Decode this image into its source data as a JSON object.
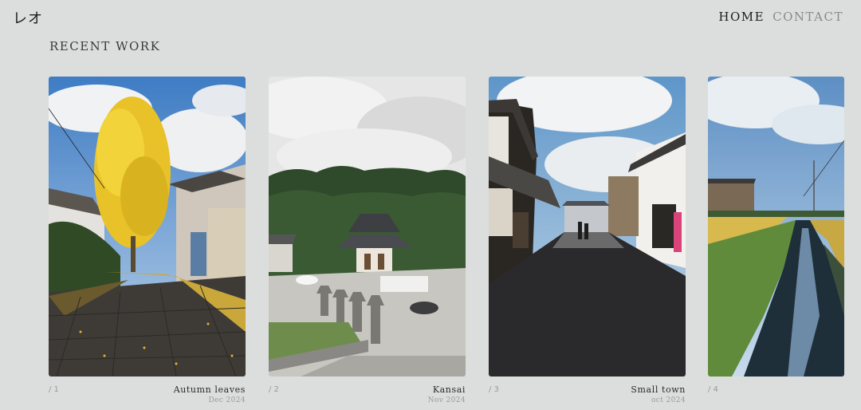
{
  "header": {
    "logo": "レオ",
    "nav": {
      "home": "HOME",
      "contact": "CONTACT"
    }
  },
  "section": {
    "title": "RECENT WORK"
  },
  "works": [
    {
      "index": "/ 1",
      "title": "Autumn leaves",
      "date": "Dec 2024"
    },
    {
      "index": "/ 2",
      "title": "Kansai",
      "date": "Nov 2024"
    },
    {
      "index": "/ 3",
      "title": "Small town",
      "date": "oct 2024"
    },
    {
      "index": "/ 4",
      "title": "",
      "date": ""
    }
  ]
}
